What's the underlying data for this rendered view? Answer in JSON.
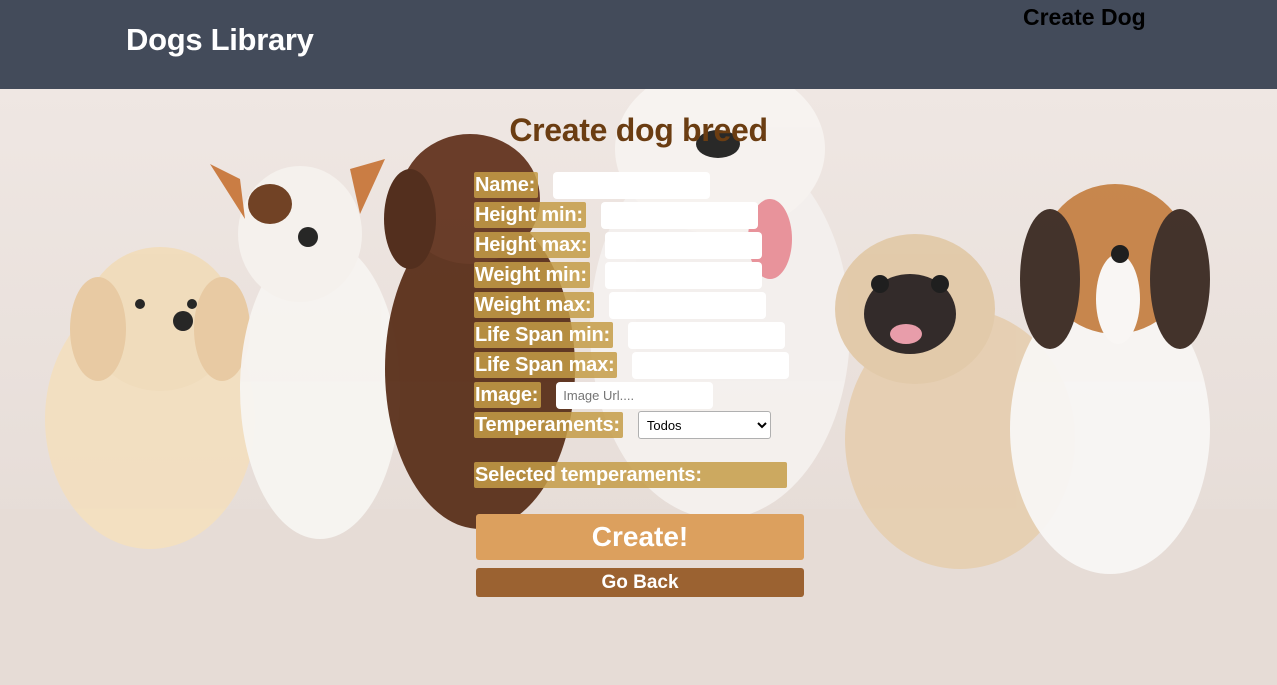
{
  "header": {
    "brand": "Dogs Library",
    "nav_create": "Create Dog"
  },
  "page": {
    "title": "Create dog breed"
  },
  "form": {
    "fields": [
      {
        "label": "Name:",
        "value": "",
        "placeholder": ""
      },
      {
        "label": "Height min:",
        "value": "",
        "placeholder": ""
      },
      {
        "label": "Height max:",
        "value": "",
        "placeholder": ""
      },
      {
        "label": "Weight min:",
        "value": "",
        "placeholder": ""
      },
      {
        "label": "Weight max:",
        "value": "",
        "placeholder": ""
      },
      {
        "label": "Life Span min:",
        "value": "",
        "placeholder": ""
      },
      {
        "label": "Life Span max:",
        "value": "",
        "placeholder": ""
      },
      {
        "label": "Image:",
        "value": "",
        "placeholder": "Image Url...."
      }
    ],
    "temperaments_label": "Temperaments:",
    "temperaments_selected": "Todos",
    "selected_label": "Selected temperaments:",
    "create_button": "Create!",
    "back_button": "Go Back"
  },
  "colors": {
    "header_bg": "#434b5a",
    "title": "#6b3d12",
    "label_bg": "#c49c46",
    "create_button": "#dca05e",
    "back_button": "#9b6231"
  },
  "background_image": "puppies-photo"
}
